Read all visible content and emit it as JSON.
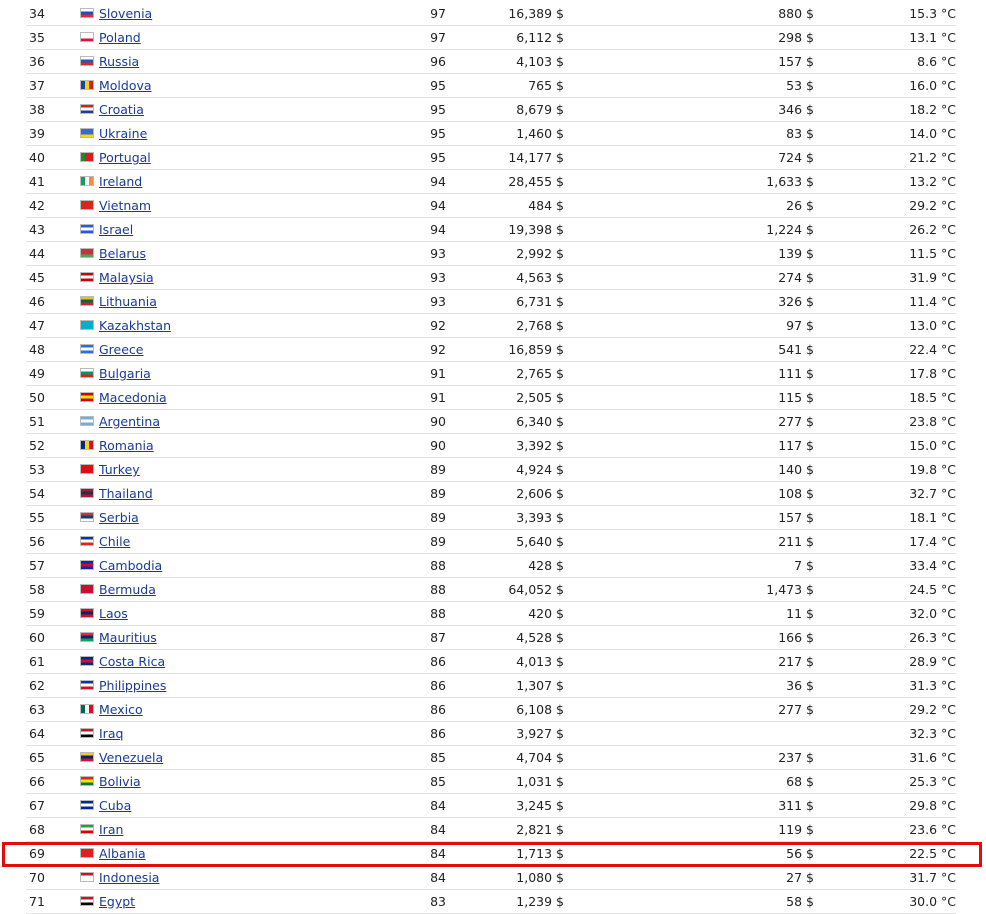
{
  "rows": [
    {
      "rank": "34",
      "country": "Slovenia",
      "score": "97",
      "gdp": "16,389 $",
      "gdp2": "880 $",
      "temp": "15.3 °C",
      "flag": [
        "#ffffff",
        "#1f4fbf",
        "#e32a2a"
      ]
    },
    {
      "rank": "35",
      "country": "Poland",
      "score": "97",
      "gdp": "6,112 $",
      "gdp2": "298 $",
      "temp": "13.1 °C",
      "flag": [
        "#ffffff",
        "#ffffff",
        "#dc143c"
      ]
    },
    {
      "rank": "36",
      "country": "Russia",
      "score": "96",
      "gdp": "4,103 $",
      "gdp2": "157 $",
      "temp": "8.6 °C",
      "flag": [
        "#ffffff",
        "#2a52be",
        "#d52b1e"
      ]
    },
    {
      "rank": "37",
      "country": "Moldova",
      "score": "95",
      "gdp": "765 $",
      "gdp2": "53 $",
      "temp": "16.0 °C",
      "flag": [
        "#1e40a8",
        "#ffd200",
        "#cc1f1f"
      ],
      "v": true
    },
    {
      "rank": "38",
      "country": "Croatia",
      "score": "95",
      "gdp": "8,679 $",
      "gdp2": "346 $",
      "temp": "18.2 °C",
      "flag": [
        "#d21f1f",
        "#ffffff",
        "#1e3d9c"
      ]
    },
    {
      "rank": "39",
      "country": "Ukraine",
      "score": "95",
      "gdp": "1,460 $",
      "gdp2": "83 $",
      "temp": "14.0 °C",
      "flag": [
        "#2e6cd6",
        "#2e6cd6",
        "#ffd500"
      ]
    },
    {
      "rank": "40",
      "country": "Portugal",
      "score": "95",
      "gdp": "14,177 $",
      "gdp2": "724 $",
      "temp": "21.2 °C",
      "flag": [
        "#1a8a2a",
        "#d21f1f",
        "#d21f1f"
      ],
      "v": true
    },
    {
      "rank": "41",
      "country": "Ireland",
      "score": "94",
      "gdp": "28,455 $",
      "gdp2": "1,633 $",
      "temp": "13.2 °C",
      "flag": [
        "#169b62",
        "#ffffff",
        "#ff883e"
      ],
      "v": true
    },
    {
      "rank": "42",
      "country": "Vietnam",
      "score": "94",
      "gdp": "484 $",
      "gdp2": "26 $",
      "temp": "29.2 °C",
      "flag": [
        "#da251d",
        "#da251d",
        "#da251d"
      ]
    },
    {
      "rank": "43",
      "country": "Israel",
      "score": "94",
      "gdp": "19,398 $",
      "gdp2": "1,224 $",
      "temp": "26.2 °C",
      "flag": [
        "#2a5bd6",
        "#ffffff",
        "#2a5bd6"
      ]
    },
    {
      "rank": "44",
      "country": "Belarus",
      "score": "93",
      "gdp": "2,992 $",
      "gdp2": "139 $",
      "temp": "11.5 °C",
      "flag": [
        "#c8313e",
        "#c8313e",
        "#4aa657"
      ]
    },
    {
      "rank": "45",
      "country": "Malaysia",
      "score": "93",
      "gdp": "4,563 $",
      "gdp2": "274 $",
      "temp": "31.9 °C",
      "flag": [
        "#cc0001",
        "#ffffff",
        "#cc0001"
      ]
    },
    {
      "rank": "46",
      "country": "Lithuania",
      "score": "93",
      "gdp": "6,731 $",
      "gdp2": "326 $",
      "temp": "11.4 °C",
      "flag": [
        "#fdb913",
        "#006a44",
        "#c1272d"
      ]
    },
    {
      "rank": "47",
      "country": "Kazakhstan",
      "score": "92",
      "gdp": "2,768 $",
      "gdp2": "97 $",
      "temp": "13.0 °C",
      "flag": [
        "#00afca",
        "#00afca",
        "#00afca"
      ]
    },
    {
      "rank": "48",
      "country": "Greece",
      "score": "92",
      "gdp": "16,859 $",
      "gdp2": "541 $",
      "temp": "22.4 °C",
      "flag": [
        "#2b6fd6",
        "#ffffff",
        "#2b6fd6"
      ]
    },
    {
      "rank": "49",
      "country": "Bulgaria",
      "score": "91",
      "gdp": "2,765 $",
      "gdp2": "111 $",
      "temp": "17.8 °C",
      "flag": [
        "#ffffff",
        "#00966e",
        "#d62612"
      ]
    },
    {
      "rank": "50",
      "country": "Macedonia",
      "score": "91",
      "gdp": "2,505 $",
      "gdp2": "115 $",
      "temp": "18.5 °C",
      "flag": [
        "#d20000",
        "#ffe600",
        "#d20000"
      ]
    },
    {
      "rank": "51",
      "country": "Argentina",
      "score": "90",
      "gdp": "6,340 $",
      "gdp2": "277 $",
      "temp": "23.8 °C",
      "flag": [
        "#74acdf",
        "#ffffff",
        "#74acdf"
      ]
    },
    {
      "rank": "52",
      "country": "Romania",
      "score": "90",
      "gdp": "3,392 $",
      "gdp2": "117 $",
      "temp": "15.0 °C",
      "flag": [
        "#002b7f",
        "#fcd116",
        "#ce1126"
      ],
      "v": true
    },
    {
      "rank": "53",
      "country": "Turkey",
      "score": "89",
      "gdp": "4,924 $",
      "gdp2": "140 $",
      "temp": "19.8 °C",
      "flag": [
        "#e30a17",
        "#e30a17",
        "#e30a17"
      ]
    },
    {
      "rank": "54",
      "country": "Thailand",
      "score": "89",
      "gdp": "2,606 $",
      "gdp2": "108 $",
      "temp": "32.7 °C",
      "flag": [
        "#a51931",
        "#2d2a4a",
        "#a51931"
      ]
    },
    {
      "rank": "55",
      "country": "Serbia",
      "score": "89",
      "gdp": "3,393 $",
      "gdp2": "157 $",
      "temp": "18.1 °C",
      "flag": [
        "#c6363c",
        "#0c4076",
        "#ffffff"
      ]
    },
    {
      "rank": "56",
      "country": "Chile",
      "score": "89",
      "gdp": "5,640 $",
      "gdp2": "211 $",
      "temp": "17.4 °C",
      "flag": [
        "#0039a6",
        "#ffffff",
        "#d52b1e"
      ]
    },
    {
      "rank": "57",
      "country": "Cambodia",
      "score": "88",
      "gdp": "428 $",
      "gdp2": "7 $",
      "temp": "33.4 °C",
      "flag": [
        "#032ea1",
        "#e00025",
        "#032ea1"
      ]
    },
    {
      "rank": "58",
      "country": "Bermuda",
      "score": "88",
      "gdp": "64,052 $",
      "gdp2": "1,473 $",
      "temp": "24.5 °C",
      "flag": [
        "#c8102e",
        "#c8102e",
        "#c8102e"
      ]
    },
    {
      "rank": "59",
      "country": "Laos",
      "score": "88",
      "gdp": "420 $",
      "gdp2": "11 $",
      "temp": "32.0 °C",
      "flag": [
        "#ce1126",
        "#002868",
        "#ce1126"
      ]
    },
    {
      "rank": "60",
      "country": "Mauritius",
      "score": "87",
      "gdp": "4,528 $",
      "gdp2": "166 $",
      "temp": "26.3 °C",
      "flag": [
        "#ea2839",
        "#1a206d",
        "#00a551"
      ]
    },
    {
      "rank": "61",
      "country": "Costa Rica",
      "score": "86",
      "gdp": "4,013 $",
      "gdp2": "217 $",
      "temp": "28.9 °C",
      "flag": [
        "#002b7f",
        "#ce1126",
        "#002b7f"
      ]
    },
    {
      "rank": "62",
      "country": "Philippines",
      "score": "86",
      "gdp": "1,307 $",
      "gdp2": "36 $",
      "temp": "31.3 °C",
      "flag": [
        "#0038a8",
        "#ffffff",
        "#ce1126"
      ]
    },
    {
      "rank": "63",
      "country": "Mexico",
      "score": "86",
      "gdp": "6,108 $",
      "gdp2": "277 $",
      "temp": "29.2 °C",
      "flag": [
        "#006847",
        "#ffffff",
        "#ce1126"
      ],
      "v": true
    },
    {
      "rank": "64",
      "country": "Iraq",
      "score": "86",
      "gdp": "3,927 $",
      "gdp2": "",
      "temp": "32.3 °C",
      "flag": [
        "#ce1126",
        "#ffffff",
        "#000000"
      ]
    },
    {
      "rank": "65",
      "country": "Venezuela",
      "score": "85",
      "gdp": "4,704 $",
      "gdp2": "237 $",
      "temp": "31.6 °C",
      "flag": [
        "#ffcc00",
        "#00247d",
        "#cf142b"
      ]
    },
    {
      "rank": "66",
      "country": "Bolivia",
      "score": "85",
      "gdp": "1,031 $",
      "gdp2": "68 $",
      "temp": "25.3 °C",
      "flag": [
        "#d52b1e",
        "#f9e300",
        "#007934"
      ]
    },
    {
      "rank": "67",
      "country": "Cuba",
      "score": "84",
      "gdp": "3,245 $",
      "gdp2": "311 $",
      "temp": "29.8 °C",
      "flag": [
        "#002a8f",
        "#ffffff",
        "#002a8f"
      ]
    },
    {
      "rank": "68",
      "country": "Iran",
      "score": "84",
      "gdp": "2,821 $",
      "gdp2": "119 $",
      "temp": "23.6 °C",
      "flag": [
        "#239f40",
        "#ffffff",
        "#da0000"
      ]
    },
    {
      "rank": "69",
      "country": "Albania",
      "score": "84",
      "gdp": "1,713 $",
      "gdp2": "56 $",
      "temp": "22.5 °C",
      "flag": [
        "#e41e20",
        "#e41e20",
        "#e41e20"
      ],
      "highlight": true
    },
    {
      "rank": "70",
      "country": "Indonesia",
      "score": "84",
      "gdp": "1,080 $",
      "gdp2": "27 $",
      "temp": "31.7 °C",
      "flag": [
        "#ce1126",
        "#ffffff",
        "#ffffff"
      ]
    },
    {
      "rank": "71",
      "country": "Egypt",
      "score": "83",
      "gdp": "1,239 $",
      "gdp2": "58 $",
      "temp": "30.0 °C",
      "flag": [
        "#ce1126",
        "#ffffff",
        "#000000"
      ]
    }
  ],
  "highlight_color": "#e30d0d"
}
